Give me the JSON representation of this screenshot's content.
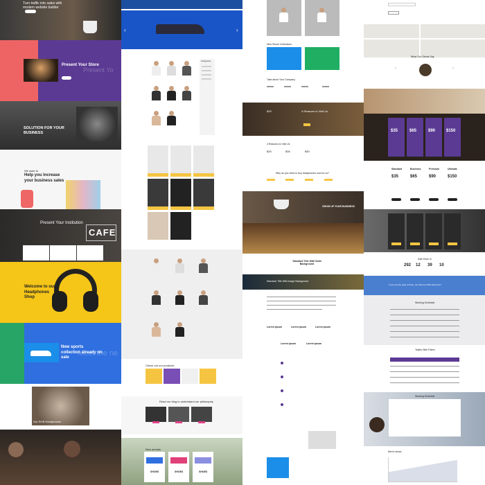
{
  "col1": {
    "hero_text": "Turn traffic into sales with modern website builder",
    "present_store": "Present Your Store",
    "present_store_bg": "Present Yo",
    "solution": "SOLUTION FOR YOUR BUSINESS",
    "we_want": "We want to",
    "help_title": "Help you increase your business sales",
    "present_institution": "Present Your Institution",
    "cafe_sign": "CAFE",
    "welcome": "Welcome to our Headphones Shop",
    "sports_title": "New sports collection already on sale",
    "sports_bg": "Meet the ne",
    "headphones_caption": "Our RGB Headphones",
    "colors": {
      "coral": "#ee6464",
      "purple": "#5b3a93",
      "yellow": "#f5c518",
      "green": "#27a567",
      "blue": "#2f6fe0"
    }
  },
  "col2": {
    "sidebar_title": "Categories",
    "check_products": "Check out our products",
    "blog_title": "Read our blog to understand our philosophy",
    "new_arrivals": "New arrivals",
    "shoe_label": "SHOES",
    "nav_labels": [
      "‹",
      "›"
    ]
  },
  "col3": {
    "new_shoes": "New Shoes Collections",
    "take_company": "Take about Your Company",
    "reasons": "4 Reasons to Visit Us",
    "why_title": "Why do you need to buy headphones now for us?",
    "grow_business": "GROW UP YOUR BUSINESS",
    "standard_title": "Standard Title With Solid Background",
    "standard_title2": "Standard Title With Image Background",
    "lorem": "Lorem ipsum",
    "prices": [
      "$25",
      "$35",
      "$45"
    ]
  },
  "col4": {
    "clients_say": "What Our Clients Say",
    "pricing_cards": [
      {
        "name": "Standard",
        "price": "$35"
      },
      {
        "name": "Business",
        "price": "$65"
      },
      {
        "name": "Premium",
        "price": "$90"
      },
      {
        "name": "Ultimate",
        "price": "$150"
      }
    ],
    "sale_ends": "Sale Ends In",
    "countdown": [
      "292",
      "12",
      "39",
      "10"
    ],
    "banner": "If you buy the pack of three, the third one 50% discount!!!",
    "working_schedule": "Working Schedule",
    "tables_filters": "Tables With Filters",
    "working_schedule2": "Working Schedule",
    "mens_shoes": "Men's shoes"
  }
}
